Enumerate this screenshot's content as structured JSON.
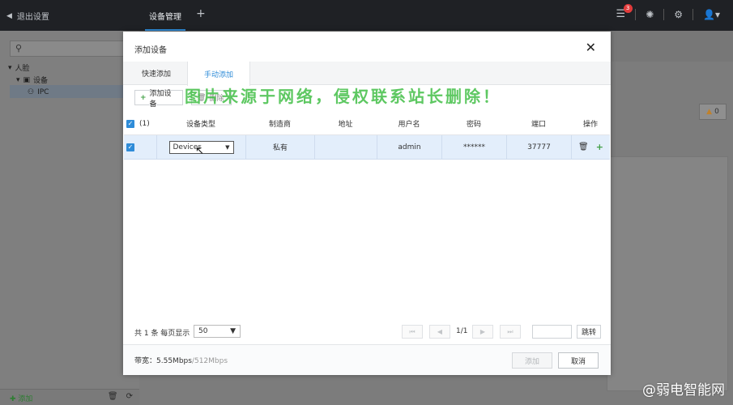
{
  "topbar": {
    "back_label": "退出设置",
    "active_tab": "设备管理",
    "add_tab": "+",
    "alarm_count": "3"
  },
  "sidebar": {
    "tree": [
      {
        "label": "人脸"
      },
      {
        "label": "设备"
      },
      {
        "label": "IPC"
      }
    ],
    "add_label": "添加"
  },
  "background": {
    "alarm_count": "0"
  },
  "dialog": {
    "title": "添加设备",
    "tabs": [
      "快速添加",
      "手动添加"
    ],
    "toolbar": {
      "add_label": "添加设备",
      "delete_label": "删除"
    },
    "watermark": "图片来源于网络，侵权联系站长删除！",
    "table": {
      "count_label": "(1)",
      "headers": [
        "设备类型",
        "制造商",
        "地址",
        "用户名",
        "密码",
        "端口",
        "操作"
      ],
      "rows": [
        {
          "device_type": "Devices",
          "manufacturer": "私有",
          "address": "",
          "username": "admin",
          "password": "******",
          "port": "37777"
        }
      ]
    },
    "pagination": {
      "total_label": "共 1 条  每页显示",
      "page_size": "50",
      "page_indicator": "1/1",
      "jump_label": "跳转"
    },
    "footer": {
      "bandwidth_label": "带宽：",
      "bandwidth_used": "5.55Mbps",
      "bandwidth_limit": "/512Mbps",
      "ok_label": "添加",
      "cancel_label": "取消"
    }
  },
  "corner_watermark": "@弱电智能网",
  "colors": {
    "accent": "#2f8cd8",
    "topbar_bg": "#1f2125",
    "watermark_green": "#42be46",
    "row_selected": "#e3eefb"
  }
}
